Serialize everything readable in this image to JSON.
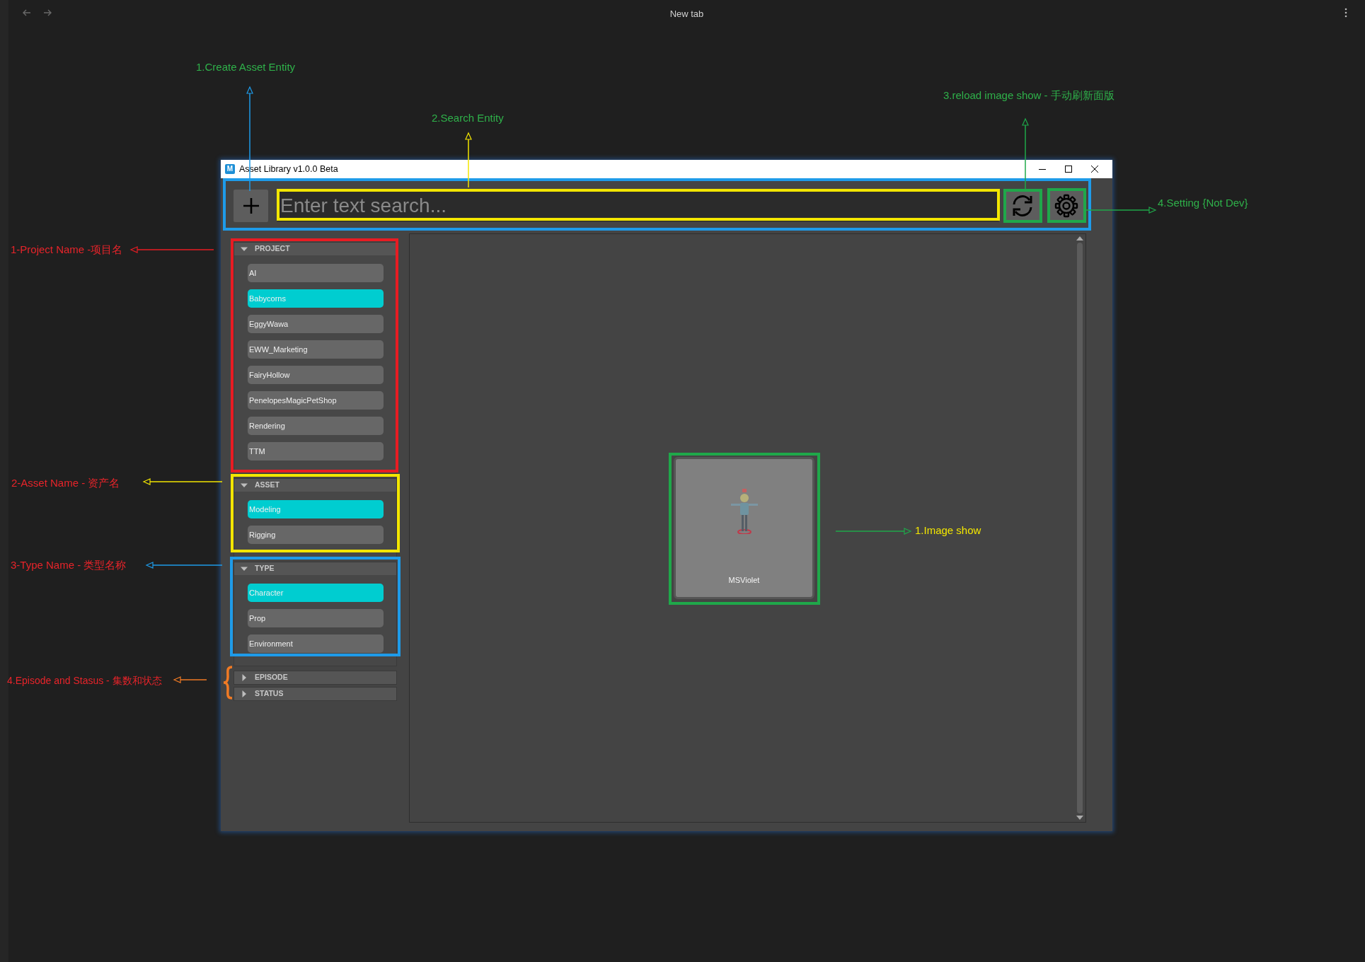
{
  "browser": {
    "title": "New tab"
  },
  "window": {
    "icon_letter": "M",
    "title": "Asset Library v1.0.0 Beta"
  },
  "toolbar": {
    "search": {
      "placeholder": "Enter text search..."
    }
  },
  "sidebar": {
    "sections": [
      {
        "title": "PROJECT",
        "expanded": true,
        "items": [
          {
            "label": "AI",
            "selected": false
          },
          {
            "label": "Babycorns",
            "selected": true
          },
          {
            "label": "EggyWawa",
            "selected": false
          },
          {
            "label": "EWW_Marketing",
            "selected": false
          },
          {
            "label": "FairyHollow",
            "selected": false
          },
          {
            "label": "PenelopesMagicPetShop",
            "selected": false
          },
          {
            "label": "Rendering",
            "selected": false
          },
          {
            "label": "TTM",
            "selected": false
          }
        ]
      },
      {
        "title": "ASSET",
        "expanded": true,
        "items": [
          {
            "label": "Modeling",
            "selected": true
          },
          {
            "label": "Rigging",
            "selected": false
          }
        ]
      },
      {
        "title": "TYPE",
        "expanded": true,
        "items": [
          {
            "label": "Character",
            "selected": true
          },
          {
            "label": "Prop",
            "selected": false
          },
          {
            "label": "Environment",
            "selected": false
          }
        ]
      },
      {
        "title": "EPISODE",
        "expanded": false
      },
      {
        "title": "STATUS",
        "expanded": false
      }
    ]
  },
  "assets": [
    {
      "name": "MSViolet"
    }
  ],
  "annotations": [
    {
      "text": "1.Create Asset Entity",
      "color": "#2fb14a"
    },
    {
      "text": "2.Search Entity",
      "color": "#2fb14a"
    },
    {
      "text": "3.reload image show - 手动刷新面版",
      "color": "#2fb14a"
    },
    {
      "text": "4.Setting {Not Dev}",
      "color": "#2fb14a"
    },
    {
      "text": "1-Project Name -项目名",
      "color": "#e8242a"
    },
    {
      "text": "2-Asset Name - 资产名",
      "color": "#e8242a"
    },
    {
      "text": "3-Type Name - 类型名称",
      "color": "#e8242a"
    },
    {
      "text": "4.Episode and Stasus - 集数和状态",
      "color": "#e8242a"
    },
    {
      "text": "1.Image show",
      "color": "#f3e600"
    }
  ]
}
